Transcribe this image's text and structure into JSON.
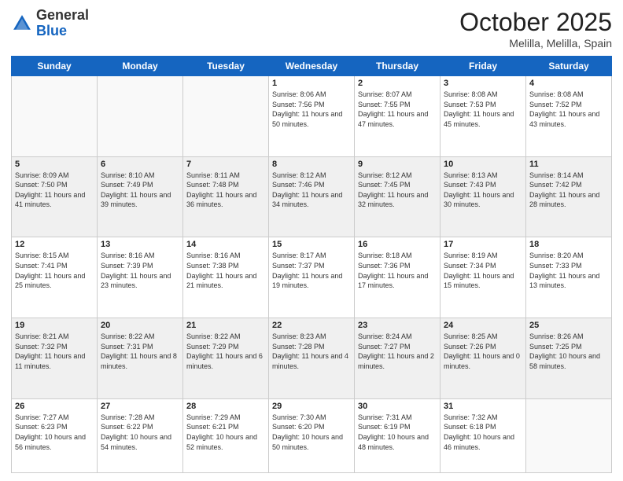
{
  "header": {
    "logo_general": "General",
    "logo_blue": "Blue",
    "month": "October 2025",
    "location": "Melilla, Melilla, Spain"
  },
  "days_of_week": [
    "Sunday",
    "Monday",
    "Tuesday",
    "Wednesday",
    "Thursday",
    "Friday",
    "Saturday"
  ],
  "weeks": [
    [
      {
        "day": "",
        "text": ""
      },
      {
        "day": "",
        "text": ""
      },
      {
        "day": "",
        "text": ""
      },
      {
        "day": "1",
        "text": "Sunrise: 8:06 AM\nSunset: 7:56 PM\nDaylight: 11 hours\nand 50 minutes."
      },
      {
        "day": "2",
        "text": "Sunrise: 8:07 AM\nSunset: 7:55 PM\nDaylight: 11 hours\nand 47 minutes."
      },
      {
        "day": "3",
        "text": "Sunrise: 8:08 AM\nSunset: 7:53 PM\nDaylight: 11 hours\nand 45 minutes."
      },
      {
        "day": "4",
        "text": "Sunrise: 8:08 AM\nSunset: 7:52 PM\nDaylight: 11 hours\nand 43 minutes."
      }
    ],
    [
      {
        "day": "5",
        "text": "Sunrise: 8:09 AM\nSunset: 7:50 PM\nDaylight: 11 hours\nand 41 minutes."
      },
      {
        "day": "6",
        "text": "Sunrise: 8:10 AM\nSunset: 7:49 PM\nDaylight: 11 hours\nand 39 minutes."
      },
      {
        "day": "7",
        "text": "Sunrise: 8:11 AM\nSunset: 7:48 PM\nDaylight: 11 hours\nand 36 minutes."
      },
      {
        "day": "8",
        "text": "Sunrise: 8:12 AM\nSunset: 7:46 PM\nDaylight: 11 hours\nand 34 minutes."
      },
      {
        "day": "9",
        "text": "Sunrise: 8:12 AM\nSunset: 7:45 PM\nDaylight: 11 hours\nand 32 minutes."
      },
      {
        "day": "10",
        "text": "Sunrise: 8:13 AM\nSunset: 7:43 PM\nDaylight: 11 hours\nand 30 minutes."
      },
      {
        "day": "11",
        "text": "Sunrise: 8:14 AM\nSunset: 7:42 PM\nDaylight: 11 hours\nand 28 minutes."
      }
    ],
    [
      {
        "day": "12",
        "text": "Sunrise: 8:15 AM\nSunset: 7:41 PM\nDaylight: 11 hours\nand 25 minutes."
      },
      {
        "day": "13",
        "text": "Sunrise: 8:16 AM\nSunset: 7:39 PM\nDaylight: 11 hours\nand 23 minutes."
      },
      {
        "day": "14",
        "text": "Sunrise: 8:16 AM\nSunset: 7:38 PM\nDaylight: 11 hours\nand 21 minutes."
      },
      {
        "day": "15",
        "text": "Sunrise: 8:17 AM\nSunset: 7:37 PM\nDaylight: 11 hours\nand 19 minutes."
      },
      {
        "day": "16",
        "text": "Sunrise: 8:18 AM\nSunset: 7:36 PM\nDaylight: 11 hours\nand 17 minutes."
      },
      {
        "day": "17",
        "text": "Sunrise: 8:19 AM\nSunset: 7:34 PM\nDaylight: 11 hours\nand 15 minutes."
      },
      {
        "day": "18",
        "text": "Sunrise: 8:20 AM\nSunset: 7:33 PM\nDaylight: 11 hours\nand 13 minutes."
      }
    ],
    [
      {
        "day": "19",
        "text": "Sunrise: 8:21 AM\nSunset: 7:32 PM\nDaylight: 11 hours\nand 11 minutes."
      },
      {
        "day": "20",
        "text": "Sunrise: 8:22 AM\nSunset: 7:31 PM\nDaylight: 11 hours\nand 8 minutes."
      },
      {
        "day": "21",
        "text": "Sunrise: 8:22 AM\nSunset: 7:29 PM\nDaylight: 11 hours\nand 6 minutes."
      },
      {
        "day": "22",
        "text": "Sunrise: 8:23 AM\nSunset: 7:28 PM\nDaylight: 11 hours\nand 4 minutes."
      },
      {
        "day": "23",
        "text": "Sunrise: 8:24 AM\nSunset: 7:27 PM\nDaylight: 11 hours\nand 2 minutes."
      },
      {
        "day": "24",
        "text": "Sunrise: 8:25 AM\nSunset: 7:26 PM\nDaylight: 11 hours\nand 0 minutes."
      },
      {
        "day": "25",
        "text": "Sunrise: 8:26 AM\nSunset: 7:25 PM\nDaylight: 10 hours\nand 58 minutes."
      }
    ],
    [
      {
        "day": "26",
        "text": "Sunrise: 7:27 AM\nSunset: 6:23 PM\nDaylight: 10 hours\nand 56 minutes."
      },
      {
        "day": "27",
        "text": "Sunrise: 7:28 AM\nSunset: 6:22 PM\nDaylight: 10 hours\nand 54 minutes."
      },
      {
        "day": "28",
        "text": "Sunrise: 7:29 AM\nSunset: 6:21 PM\nDaylight: 10 hours\nand 52 minutes."
      },
      {
        "day": "29",
        "text": "Sunrise: 7:30 AM\nSunset: 6:20 PM\nDaylight: 10 hours\nand 50 minutes."
      },
      {
        "day": "30",
        "text": "Sunrise: 7:31 AM\nSunset: 6:19 PM\nDaylight: 10 hours\nand 48 minutes."
      },
      {
        "day": "31",
        "text": "Sunrise: 7:32 AM\nSunset: 6:18 PM\nDaylight: 10 hours\nand 46 minutes."
      },
      {
        "day": "",
        "text": ""
      }
    ]
  ]
}
